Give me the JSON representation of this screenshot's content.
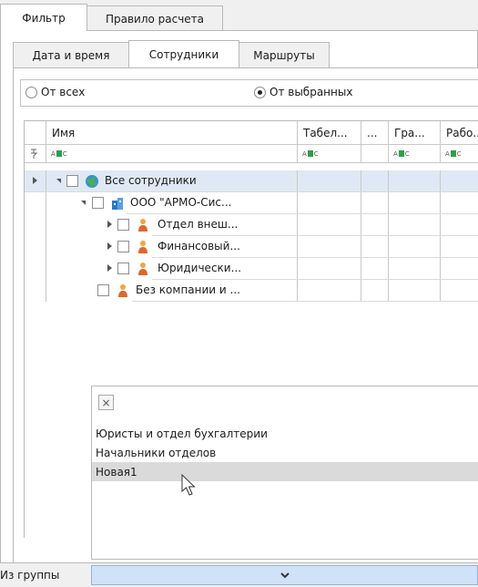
{
  "tabs_top": [
    "Фильтр",
    "Правило расчета"
  ],
  "tabs_sub": [
    "Дата и время",
    "Сотрудники",
    "Маршруты"
  ],
  "radio": {
    "all": "От всех",
    "selected": "От выбранных",
    "checked": "selected"
  },
  "grid": {
    "columns": [
      "Имя",
      "Табел...",
      "...",
      "Гра...",
      "Рабо..."
    ],
    "filter_icon": "abc-filter-icon",
    "rows": [
      {
        "label": "Все сотрудники",
        "icon": "globe-icon",
        "expander": "down"
      },
      {
        "label": "ООО \"АРМО-Сис...",
        "icon": "company-icon",
        "expander": "down"
      },
      {
        "label": "Отдел внеш...",
        "icon": "department-icon",
        "expander": "right"
      },
      {
        "label": "Финансовый...",
        "icon": "department-icon",
        "expander": "right"
      },
      {
        "label": "Юридически...",
        "icon": "department-icon",
        "expander": "right"
      },
      {
        "label": "Без компании и ...",
        "icon": "department-icon",
        "expander": "none"
      }
    ]
  },
  "popup": {
    "close": "×",
    "items": [
      "Юристы и отдел бухгалтерии",
      "Начальники отделов",
      "Новая1"
    ],
    "highlighted_index": 2
  },
  "footer": {
    "label": "Из группы",
    "dropdown_icon": "chevron-down-icon"
  },
  "colors": {
    "selected_row": "#dfe9f5",
    "combo_bg": "#cfe2f7",
    "popup_highlight": "#dadada"
  }
}
